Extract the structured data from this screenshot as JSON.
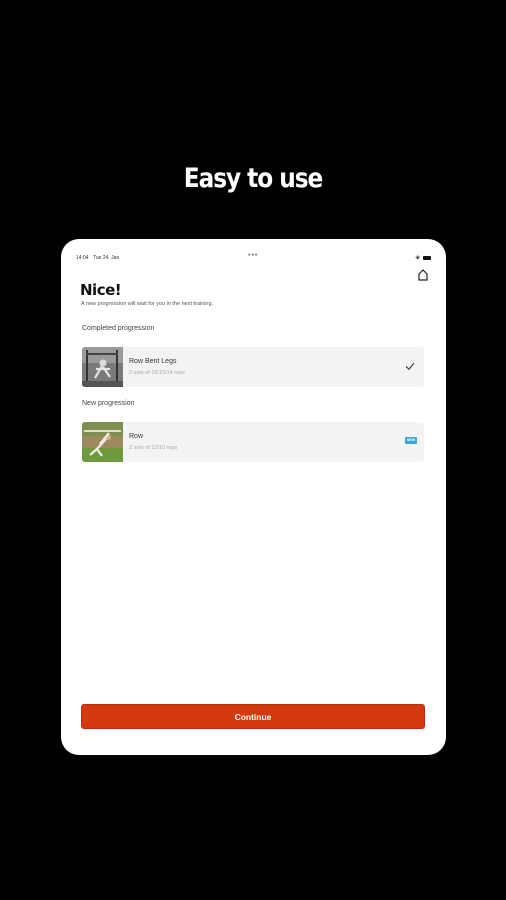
{
  "headline": "Easy to use",
  "status_bar": {
    "time": "14:04",
    "date": "Tue 24. Jan",
    "dots": "•••"
  },
  "title": "Nice!",
  "subtitle": "A new progression will wait for you in the next training.",
  "completed_section": {
    "label": "Completed progression",
    "exercise": {
      "name": "Row Bent Legs",
      "sets": "2 sets of 16/15/14 reps"
    }
  },
  "new_section": {
    "label": "New progression",
    "exercise": {
      "name": "Row",
      "sets": "2 sets of 12/10 reps",
      "badge": "NEW"
    }
  },
  "continue_label": "Continue",
  "colors": {
    "accent": "#d33a10",
    "badge": "#3aa6d8",
    "card_bg": "#f3f3f3"
  }
}
